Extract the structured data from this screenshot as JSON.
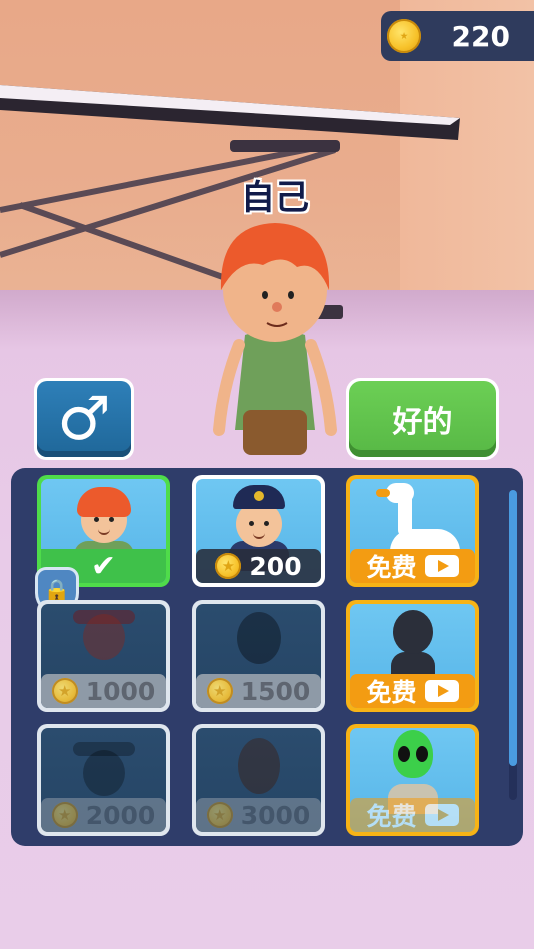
{
  "hud": {
    "coins": "220",
    "coin_icon": "coin-icon"
  },
  "scene": {
    "player_name": "自己"
  },
  "buttons": {
    "gender_symbol": "♂",
    "ok_label": "好的"
  },
  "colors": {
    "panel": "#2f3d6a",
    "ok_green": "#57b845",
    "gender_blue": "#1f6799",
    "free_orange": "#f39c12",
    "selected_green": "#4fdc4a"
  },
  "skins": [
    {
      "id": "default",
      "state": "selected",
      "check": "✔"
    },
    {
      "id": "police",
      "state": "buy",
      "price": "200"
    },
    {
      "id": "goose",
      "state": "free",
      "label": "免费"
    },
    {
      "id": "pirate",
      "state": "locked",
      "price": "1000"
    },
    {
      "id": "ninja",
      "state": "locked",
      "price": "1500"
    },
    {
      "id": "shadow",
      "state": "free",
      "label": "免费"
    },
    {
      "id": "cowboy",
      "state": "locked",
      "price": "2000"
    },
    {
      "id": "bearded",
      "state": "locked",
      "price": "3000"
    },
    {
      "id": "alien",
      "state": "free",
      "label": "免费"
    }
  ],
  "lock_icon": "🔒"
}
